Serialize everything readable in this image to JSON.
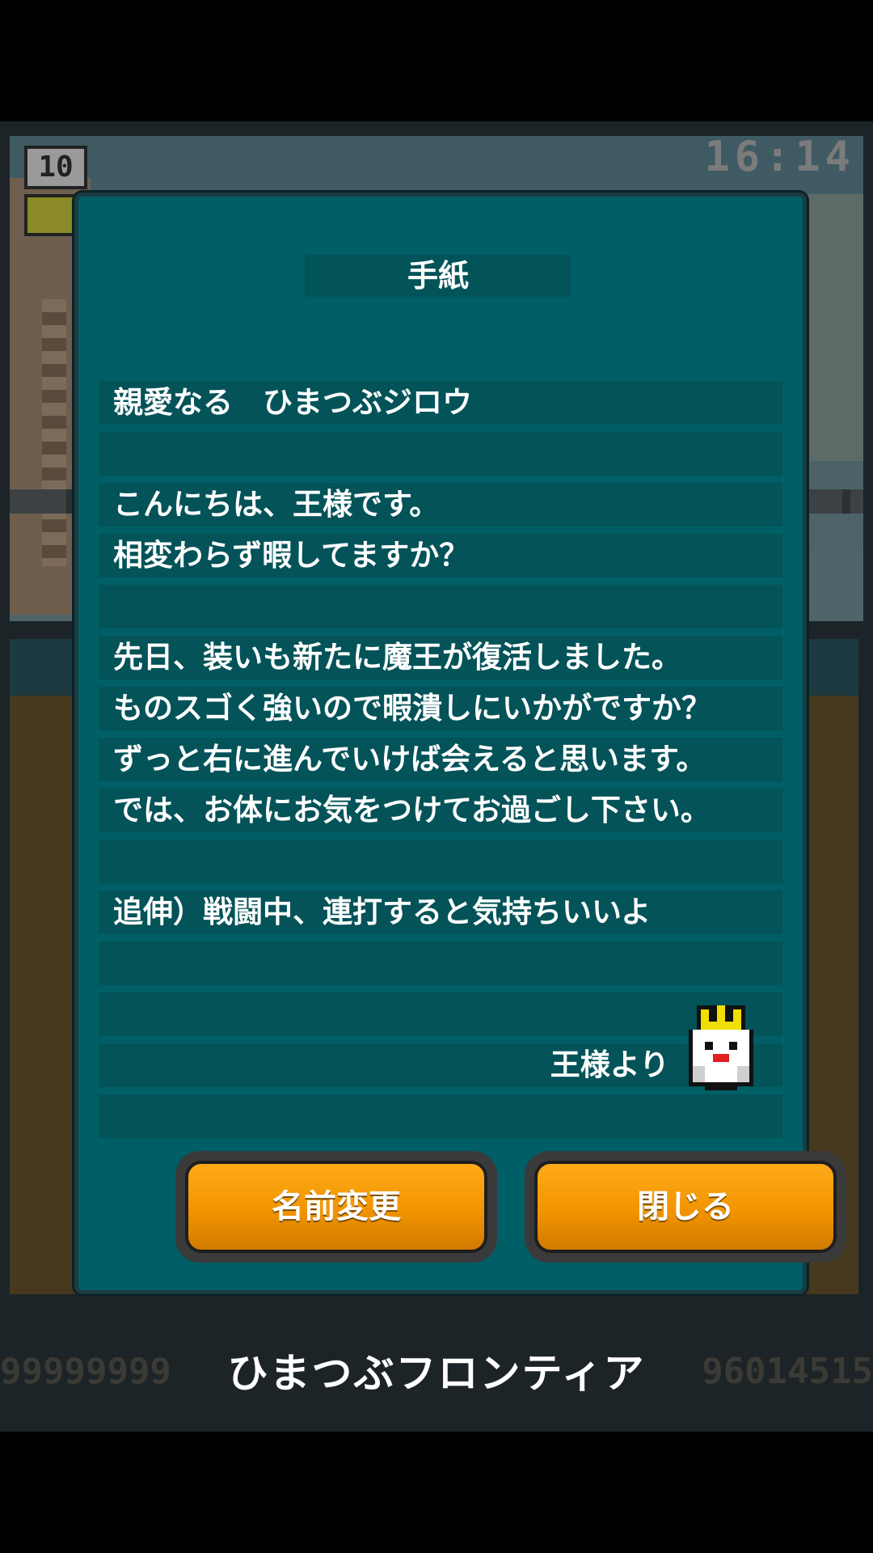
{
  "hud": {
    "level": "10",
    "clock": "16:14"
  },
  "background": {
    "bottom_left_number": "99999999",
    "bottom_right_number": "96014515",
    "game_title": "ひまつぶフロンティア"
  },
  "letter": {
    "title": "手紙",
    "lines": [
      "親愛なる　ひまつぶジロウ",
      "",
      "こんにちは、王様です。",
      "相変わらず暇してますか？",
      "",
      "先日、装いも新たに魔王が復活しました。",
      "ものスゴく強いので暇潰しにいかがですか？",
      "ずっと右に進んでいけば会えると思います。",
      "では、お体にお気をつけてお過ごし下さい。",
      "",
      "追伸）戦闘中、連打すると気持ちいいよ",
      "",
      "",
      "王様より",
      ""
    ],
    "sender_icon": "king-icon"
  },
  "buttons": {
    "rename_label": "名前変更",
    "close_label": "閉じる"
  },
  "colors": {
    "modal_bg": "#005f66",
    "line_bg": "#035359",
    "button_orange": "#f29400"
  }
}
